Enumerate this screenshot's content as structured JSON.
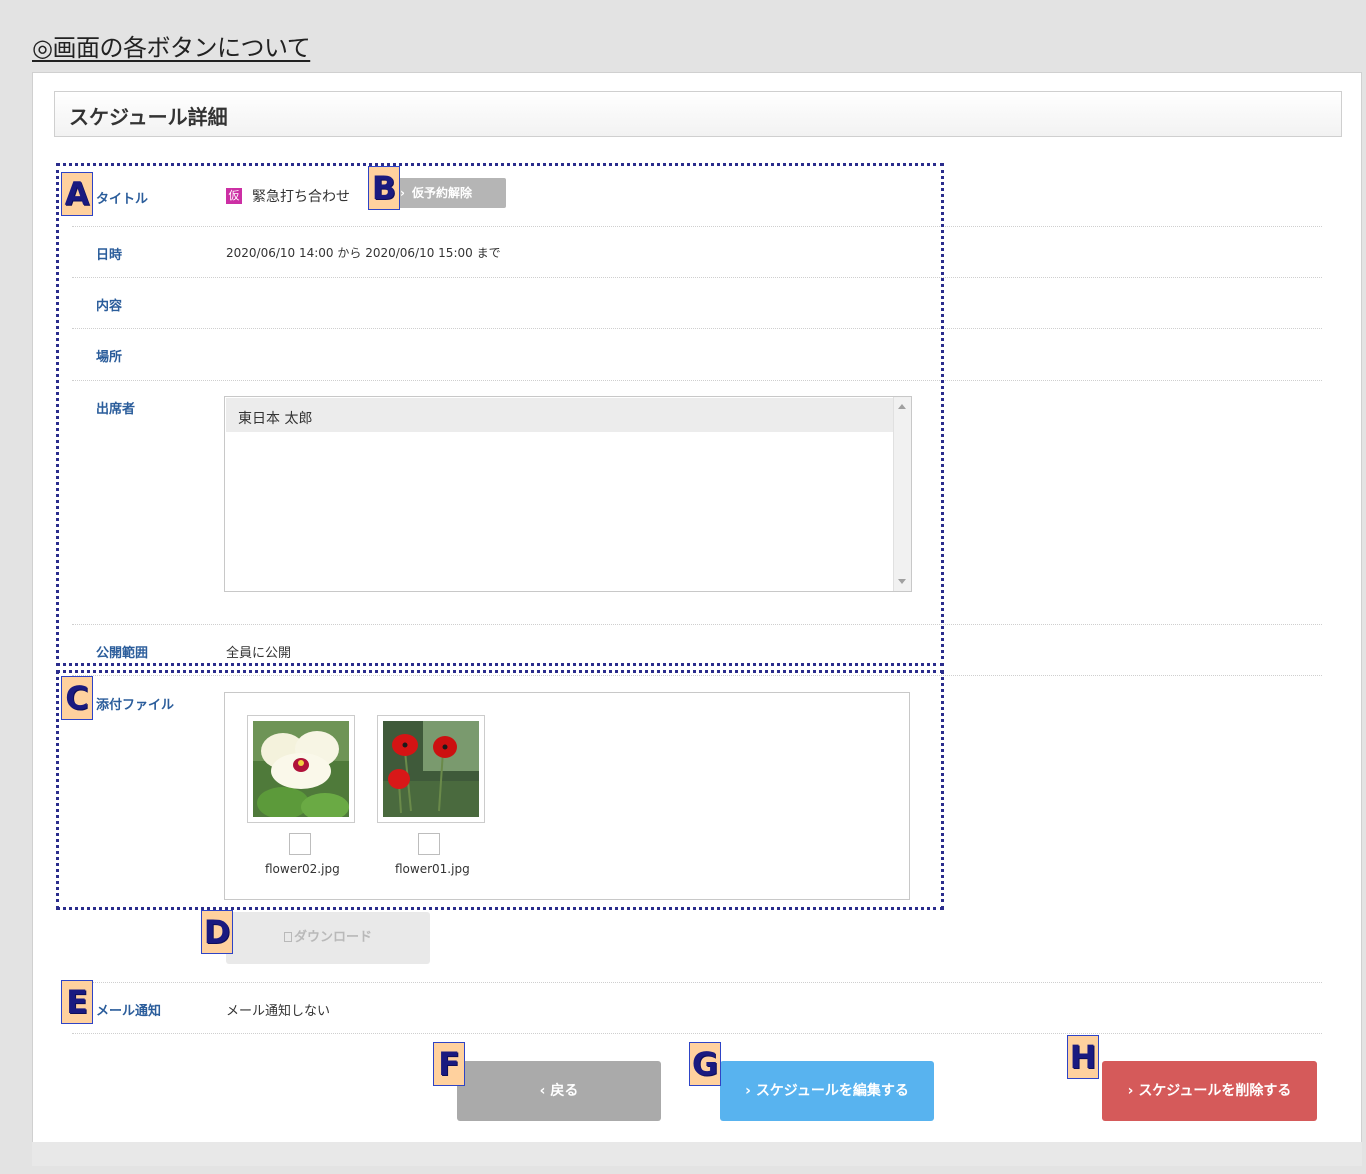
{
  "page": {
    "heading": "◎画面の各ボタンについて",
    "title": "スケジュール詳細"
  },
  "fields": {
    "title_label": "タイトル",
    "kari_badge": "仮",
    "title_value": "緊急打ち合わせ",
    "release_button": "仮予約解除",
    "datetime_label": "日時",
    "datetime_value": "2020/06/10 14:00 から 2020/06/10 15:00 まで",
    "content_label": "内容",
    "place_label": "場所",
    "attendees_label": "出席者",
    "attendees": [
      "東日本 太郎"
    ],
    "visibility_label": "公開範囲",
    "visibility_value": "全員に公開",
    "attachments_label": "添付ファイル",
    "attachments": [
      {
        "name": "flower02.jpg",
        "image": "white-pansy-photo"
      },
      {
        "name": "flower01.jpg",
        "image": "red-poppies-photo"
      }
    ],
    "download_button": "ダウンロード",
    "mail_label": "メール通知",
    "mail_value": "メール通知しない"
  },
  "actions": {
    "back": "戻る",
    "edit": "スケジュールを編集する",
    "delete": "スケジュールを削除する"
  },
  "markers": [
    "A",
    "B",
    "C",
    "D",
    "E",
    "F",
    "G",
    "H"
  ],
  "colors": {
    "label_blue": "#2b5d9b",
    "kari_magenta": "#cc2fa4",
    "edit_blue": "#58b3ef",
    "delete_red": "#d55a5a",
    "back_gray": "#aaaaaa",
    "marker_fill": "#ffd19e",
    "annotation_navy": "#2a2c8c"
  }
}
